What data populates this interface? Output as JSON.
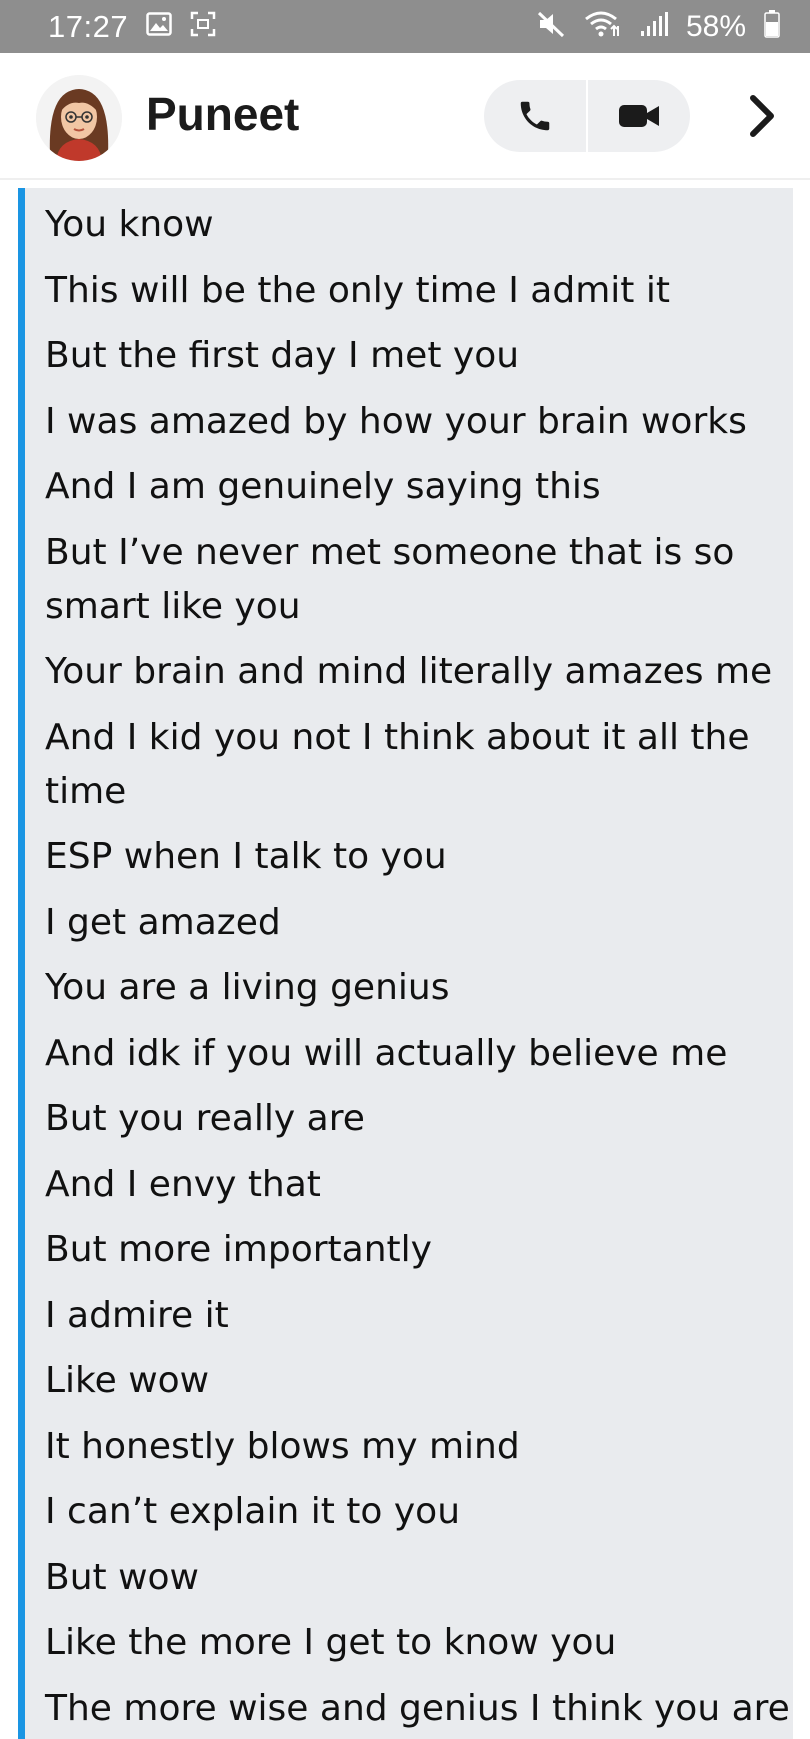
{
  "status_bar": {
    "time": "17:27",
    "battery_percent": "58%",
    "left_icons": [
      "gallery-icon",
      "screenshot-icon"
    ],
    "right_icons": [
      "mute-icon",
      "wifi-icon",
      "signal-icon",
      "battery-icon"
    ]
  },
  "header": {
    "contact_name": "Puneet",
    "avatar_icon": "bitmoji-avatar",
    "call_icon": "phone-icon",
    "video_icon": "video-camera-icon",
    "more_icon": "chevron-right-icon"
  },
  "colors": {
    "status_bar_bg": "#8e8e8e",
    "message_bg": "#e9ebee",
    "accent_bar": "#1a95e3",
    "call_group_bg": "#eeeff1"
  },
  "messages": [
    "You know",
    "This will be the only time I admit it",
    "But the first day I met you",
    "I was amazed by how your brain works",
    "And I am genuinely saying this",
    "But I’ve never met someone that is so smart like you",
    "Your brain and mind literally amazes me",
    "And I kid you not I think about it all the time",
    "ESP when I talk to you",
    "I get amazed",
    "You are a living genius",
    "And idk if you will actually believe me",
    "But you really are",
    "And I envy that",
    "But more importantly",
    "I admire it",
    "Like wow",
    "It honestly blows my mind",
    "I can’t explain it to you",
    "But wow",
    "Like the more I get to know you",
    "The more wise and genius I think you are"
  ]
}
